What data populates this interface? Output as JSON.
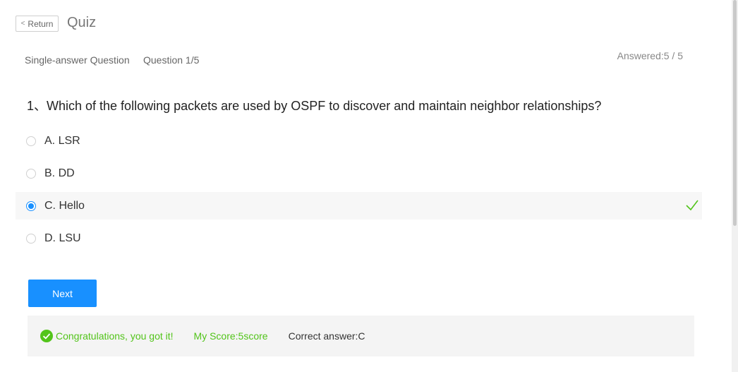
{
  "header": {
    "return_label": "Return",
    "title": "Quiz"
  },
  "meta": {
    "question_type": "Single-answer Question",
    "question_number": "Question 1/5",
    "answered": "Answered:5 / 5"
  },
  "question": {
    "text": "1、Which of the following packets are used by OSPF to discover and maintain neighbor relationships?"
  },
  "options": [
    {
      "label": "A. LSR",
      "selected": false
    },
    {
      "label": "B. DD",
      "selected": false
    },
    {
      "label": "C. Hello",
      "selected": true,
      "correct": true
    },
    {
      "label": "D. LSU",
      "selected": false
    }
  ],
  "actions": {
    "next_label": "Next"
  },
  "result": {
    "message": "Congratulations, you got it!",
    "score": "My Score:5score",
    "correct_answer": "Correct answer:C"
  },
  "colors": {
    "accent": "#1890ff",
    "success": "#52c41a"
  }
}
